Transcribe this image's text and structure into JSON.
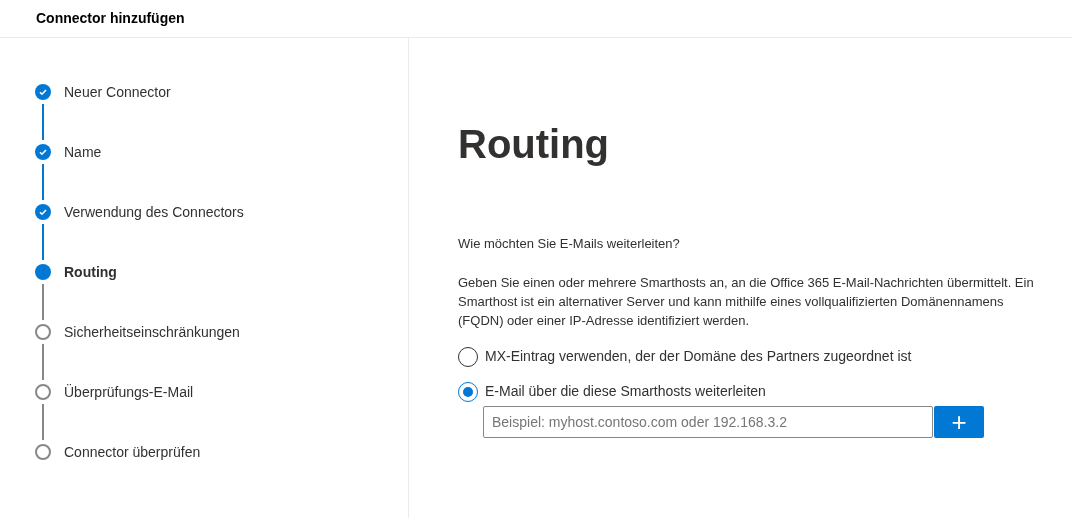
{
  "window": {
    "title": "Connector hinzufügen"
  },
  "steps": [
    {
      "label": "Neuer Connector",
      "completed": true,
      "selected": false
    },
    {
      "label": "Name",
      "completed": true,
      "selected": false
    },
    {
      "label": "Verwendung des Connectors",
      "completed": true,
      "selected": false
    },
    {
      "label": "Routing",
      "completed": false,
      "selected": true
    },
    {
      "label": "Sicherheitseinschränkungen",
      "completed": false,
      "selected": false
    },
    {
      "label": "Überprüfungs-E-Mail",
      "completed": false,
      "selected": false
    },
    {
      "label": "Connector überprüfen",
      "completed": false,
      "selected": false
    }
  ],
  "page": {
    "heading": "Routing",
    "question": "Wie möchten Sie E-Mails weiterleiten?",
    "description": "Geben Sie einen oder mehrere Smarthosts an, an die Office 365 E-Mail-Nachrichten übermittelt. Ein Smarthost ist ein alternativer Server und kann mithilfe eines vollqualifizierten Domänennamens (FQDN) oder einer IP-Adresse identifiziert werden.",
    "options": [
      {
        "label": "MX-Eintrag verwenden, der der Domäne des Partners zugeordnet ist",
        "selected": false
      },
      {
        "label": "E-Mail über die diese Smarthosts weiterleiten",
        "selected": true
      }
    ],
    "smarthost_field": {
      "placeholder": "Beispiel: myhost.contoso.com oder 192.168.3.2"
    },
    "add_button": {
      "label": "+"
    }
  }
}
